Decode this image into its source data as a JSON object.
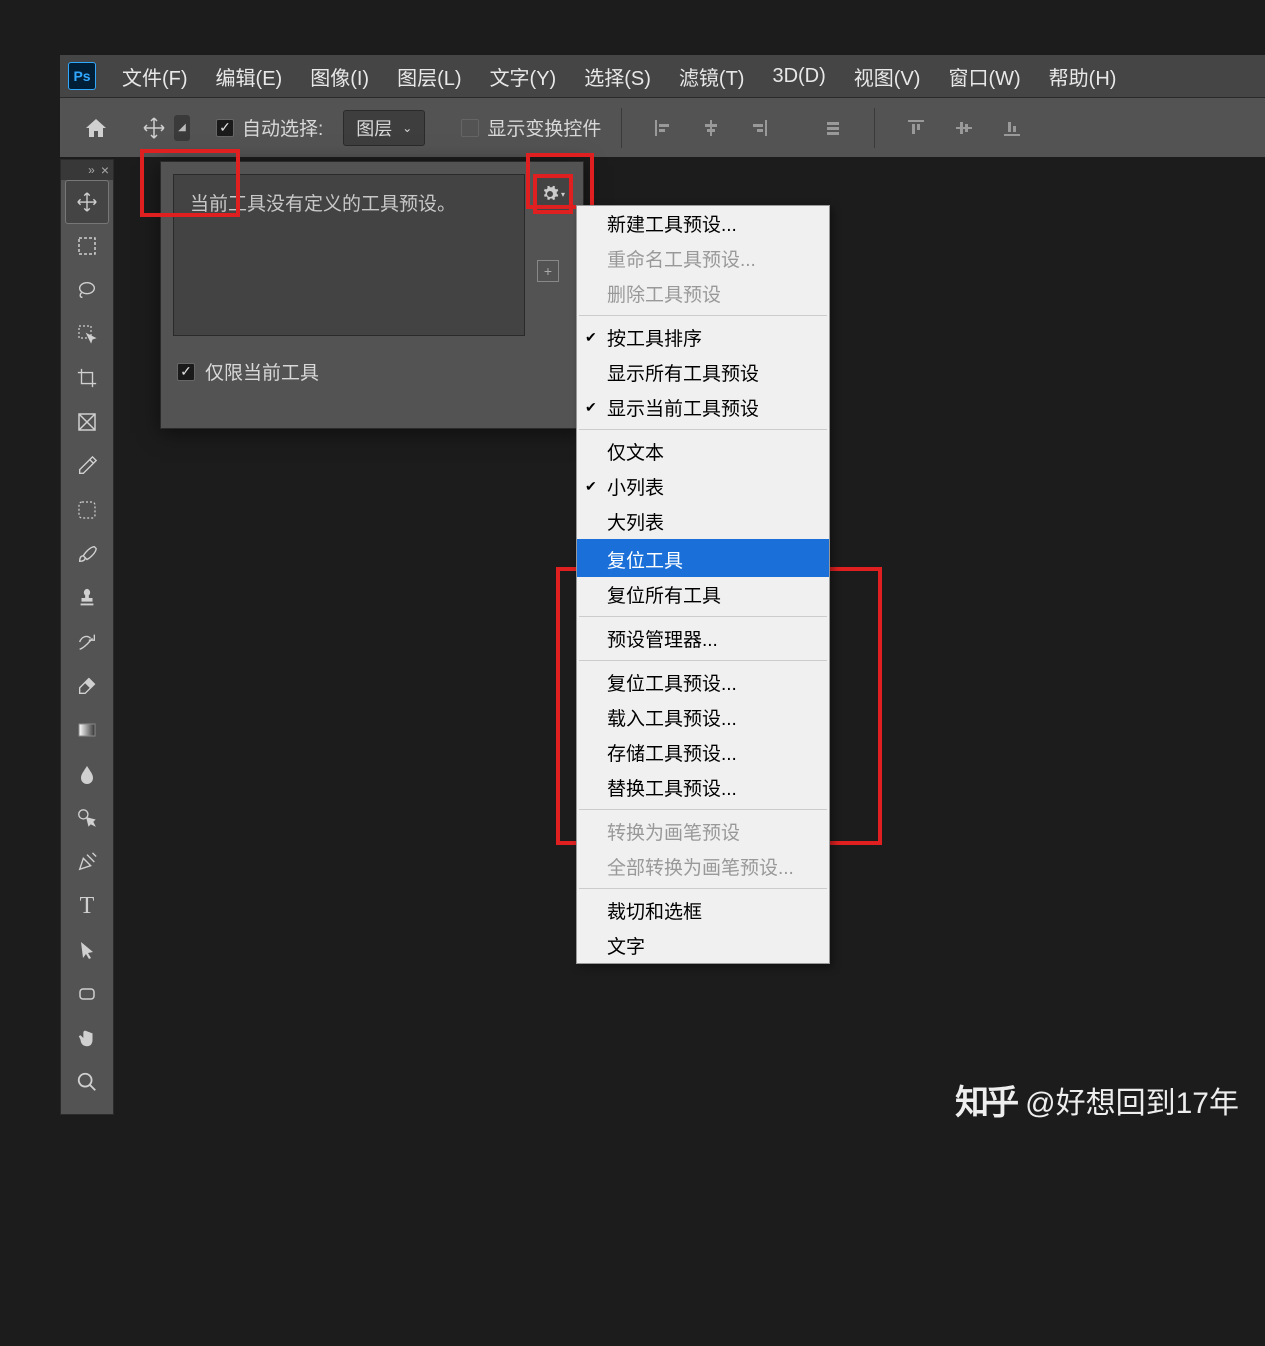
{
  "app_logo": "Ps",
  "menubar": [
    "文件(F)",
    "编辑(E)",
    "图像(I)",
    "图层(L)",
    "文字(Y)",
    "选择(S)",
    "滤镜(T)",
    "3D(D)",
    "视图(V)",
    "窗口(W)",
    "帮助(H)"
  ],
  "options": {
    "auto_select_label": "自动选择:",
    "auto_select_checked": true,
    "layer_select": "图层",
    "show_transform_label": "显示变换控件",
    "show_transform_checked": false
  },
  "preset": {
    "empty_msg": "当前工具没有定义的工具预设。",
    "only_current_label": "仅限当前工具",
    "only_current_checked": true
  },
  "context_menu": [
    {
      "label": "新建工具预设...",
      "type": "item"
    },
    {
      "label": "重命名工具预设...",
      "type": "item",
      "disabled": true
    },
    {
      "label": "删除工具预设",
      "type": "item",
      "disabled": true
    },
    {
      "type": "sep"
    },
    {
      "label": "按工具排序",
      "type": "item",
      "checked": true
    },
    {
      "label": "显示所有工具预设",
      "type": "item"
    },
    {
      "label": "显示当前工具预设",
      "type": "item",
      "checked": true
    },
    {
      "type": "sep"
    },
    {
      "label": "仅文本",
      "type": "item"
    },
    {
      "label": "小列表",
      "type": "item",
      "checked": true
    },
    {
      "label": "大列表",
      "type": "item"
    },
    {
      "type": "bluesep"
    },
    {
      "label": "复位工具",
      "type": "item",
      "selected": true
    },
    {
      "label": "复位所有工具",
      "type": "item"
    },
    {
      "type": "sep"
    },
    {
      "label": "预设管理器...",
      "type": "item"
    },
    {
      "type": "sep"
    },
    {
      "label": "复位工具预设...",
      "type": "item"
    },
    {
      "label": "载入工具预设...",
      "type": "item"
    },
    {
      "label": "存储工具预设...",
      "type": "item"
    },
    {
      "label": "替换工具预设...",
      "type": "item"
    },
    {
      "type": "sep"
    },
    {
      "label": "转换为画笔预设",
      "type": "item",
      "disabled": true
    },
    {
      "label": "全部转换为画笔预设...",
      "type": "item",
      "disabled": true
    },
    {
      "type": "sep"
    },
    {
      "label": "裁切和选框",
      "type": "item"
    },
    {
      "label": "文字",
      "type": "item"
    }
  ],
  "watermark": "@好想回到17年",
  "watermark_brand": "知乎"
}
